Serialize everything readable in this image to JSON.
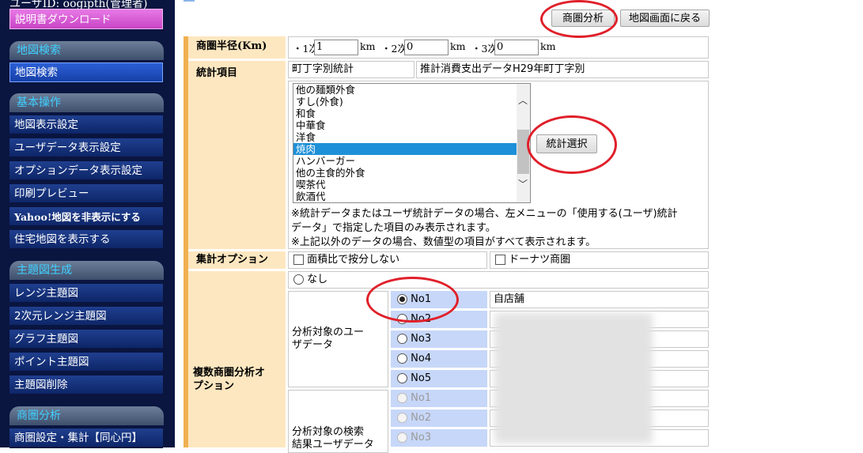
{
  "sidebar": {
    "user_id": "ユーザID: oogipth(管理者)",
    "manual_download": "説明書ダウンロード",
    "sections": [
      {
        "title": "地図検索",
        "items": [
          "地図検索"
        ]
      },
      {
        "title": "基本操作",
        "items": [
          "地図表示設定",
          "ユーザデータ表示設定",
          "オプションデータ表示設定",
          "印刷プレビュー",
          "Yahoo!地図を非表示にする",
          "住宅地図を表示する"
        ]
      },
      {
        "title": "主題図生成",
        "items": [
          "レンジ主題図",
          "2次元レンジ主題図",
          "グラフ主題図",
          "ポイント主題図",
          "主題図削除"
        ]
      },
      {
        "title": "商圏分析",
        "items": [
          "商圏設定・集計【同心円】"
        ]
      }
    ]
  },
  "toolbar": {
    "analyze_button": "商圏分析",
    "back_button": "地図画面に戻る"
  },
  "radius": {
    "label": "商圏半径(Km)",
    "rings": [
      {
        "prefix": "・1次",
        "value": "1",
        "unit": "km"
      },
      {
        "prefix": "・2次",
        "value": "0",
        "unit": "km"
      },
      {
        "prefix": "・3次",
        "value": "0",
        "unit": "km"
      }
    ]
  },
  "stats": {
    "label": "統計項目",
    "category": "町丁字別統計",
    "dataset": "推計消費支出データH29年町丁字別",
    "options": [
      "他の麺類外食",
      "すし(外食)",
      "和食",
      "中華食",
      "洋食",
      "焼肉",
      "ハンバーガー",
      "他の主食的外食",
      "喫茶代",
      "飲酒代"
    ],
    "selected": "焼肉",
    "select_button": "統計選択",
    "note_1": "※統計データまたはユーザ統計データの場合、左メニューの「使用する(ユーザ)統計",
    "note_2": "データ」で指定した項目のみ表示されます。",
    "note_3": "※上記以外のデータの場合、数値型の項目がすべて表示されます。"
  },
  "agg_options": {
    "label": "集計オプション",
    "area_ratio": "面積比で按分しない",
    "donut": "ドーナツ商圏"
  },
  "multi": {
    "label_1": "複数商圏分析オ",
    "label_2": "プション",
    "none": "なし",
    "user_group_label_1": "分析対象のユー",
    "user_group_label_2": "ザデータ",
    "user_items": [
      {
        "no": "No1",
        "value": "自店舗",
        "checked": true
      },
      {
        "no": "No2",
        "value": ""
      },
      {
        "no": "No3",
        "value": ""
      },
      {
        "no": "No4",
        "value": ""
      },
      {
        "no": "No5",
        "value": ""
      }
    ],
    "search_group_label_1": "分析対象の検索",
    "search_group_label_2": "結果ユーザデータ",
    "search_items": [
      {
        "no": "No1",
        "value": ""
      },
      {
        "no": "No2",
        "value": ""
      },
      {
        "no": "No3",
        "value": ""
      }
    ]
  },
  "colors": {
    "sidebar_bg": "#0a1540",
    "label_bg": "#fde7c0",
    "selected_option": "#1e90d8",
    "annotation": "#e0202a"
  }
}
